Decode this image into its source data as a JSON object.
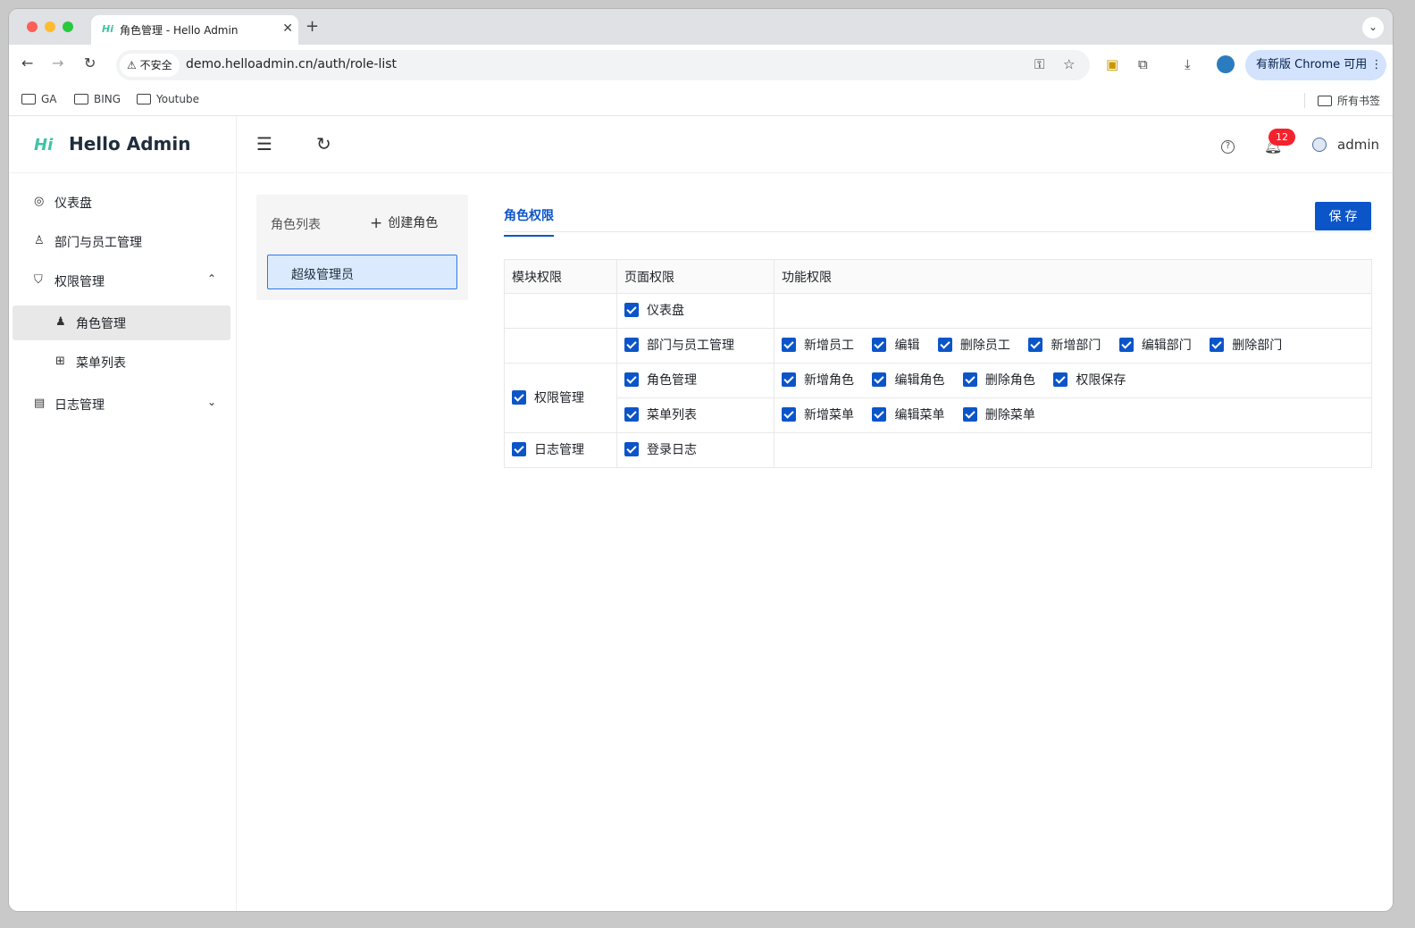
{
  "browser": {
    "tab_title": "角色管理 - Hello Admin",
    "tab_favicon": "Hi",
    "security_label": "不安全",
    "url": "demo.helloadmin.cn/auth/role-list",
    "update_label": "有新版 Chrome 可用",
    "bookmarks": [
      "GA",
      "BING",
      "Youtube"
    ],
    "all_bookmarks": "所有书签"
  },
  "app": {
    "logo": "Hi",
    "name": "Hello Admin",
    "accent_color": "#0c55c9",
    "logo_color": "#3ec3a5"
  },
  "sidebar": {
    "items": [
      {
        "label": "仪表盘",
        "icon": "dashboard-icon"
      },
      {
        "label": "部门与员工管理",
        "icon": "user-icon"
      },
      {
        "label": "权限管理",
        "icon": "shield-icon",
        "expanded": true
      },
      {
        "label": "角色管理",
        "icon": "role-icon",
        "active": true
      },
      {
        "label": "菜单列表",
        "icon": "grid-icon"
      },
      {
        "label": "日志管理",
        "icon": "log-icon",
        "expanded": false
      }
    ]
  },
  "header": {
    "notification_count": "12",
    "username": "admin"
  },
  "role_panel": {
    "title": "角色列表",
    "create_label": "创建角色",
    "roles": [
      "超级管理员"
    ]
  },
  "permissions": {
    "tab_label": "角色权限",
    "save_label": "保存",
    "headers": [
      "模块权限",
      "页面权限",
      "功能权限"
    ],
    "modules": [
      "权限管理",
      "日志管理"
    ],
    "pages": [
      "仪表盘",
      "部门与员工管理",
      "角色管理",
      "菜单列表",
      "登录日志"
    ],
    "functions": {
      "dept": [
        "新增员工",
        "编辑",
        "删除员工",
        "新增部门",
        "编辑部门",
        "删除部门"
      ],
      "role": [
        "新增角色",
        "编辑角色",
        "删除角色",
        "权限保存"
      ],
      "menu": [
        "新增菜单",
        "编辑菜单",
        "删除菜单"
      ]
    }
  }
}
